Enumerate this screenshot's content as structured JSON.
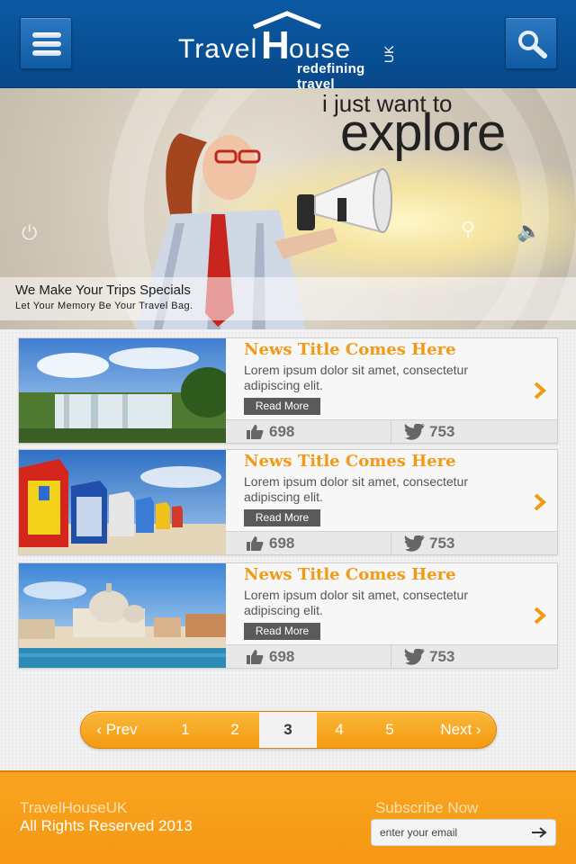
{
  "header": {
    "logo_travel": "Travel",
    "logo_h": "H",
    "logo_ouse": "ouse",
    "logo_uk": "UK",
    "logo_tagline": "redefining travel",
    "menu_icon": "hamburger-icon",
    "search_icon": "search-icon",
    "bg_color": "#0b5aa3"
  },
  "hero": {
    "tagline_small": "i just want to",
    "tagline_big": "explore",
    "caption_title": "We Make Your Trips Specials",
    "caption_sub": "Let Your Memory Be Your Travel Bag."
  },
  "news": [
    {
      "title": "News Title Comes Here",
      "body": "Lorem ipsum dolor sit amet, consectetur adipiscing elit.",
      "read_more": "Read More",
      "likes": "698",
      "tweets": "753",
      "image": "waterfall-photo"
    },
    {
      "title": "News Title Comes Here",
      "body": "Lorem ipsum dolor sit amet, consectetur adipiscing elit.",
      "read_more": "Read More",
      "likes": "698",
      "tweets": "753",
      "image": "beach-huts-photo"
    },
    {
      "title": "News Title Comes Here",
      "body": "Lorem ipsum dolor sit amet, consectetur adipiscing elit.",
      "read_more": "Read More",
      "likes": "698",
      "tweets": "753",
      "image": "venice-photo"
    }
  ],
  "pagination": {
    "prev": "Prev",
    "next": "Next",
    "pages": [
      "1",
      "2",
      "3",
      "4",
      "5"
    ],
    "current": "3",
    "accent": "#f7a423"
  },
  "footer": {
    "brand": "TravelHouseUK",
    "rights": "All Rights Reserved 2013",
    "subscribe_label": "Subscribe Now",
    "email_placeholder": "enter your email",
    "submit_icon": "arrow-right-icon",
    "bg_color": "#f79d18"
  }
}
